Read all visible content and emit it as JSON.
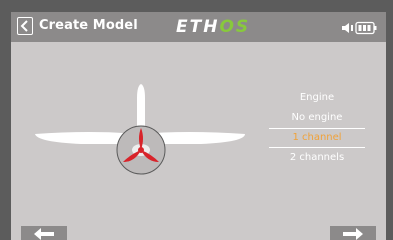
{
  "header": {
    "title": "Create Model",
    "logo_main": "ETH",
    "logo_accent": "OS"
  },
  "selector": {
    "label": "Engine",
    "options": [
      "No engine",
      "1 channel",
      "2 channels"
    ],
    "selected_index": 1
  },
  "colors": {
    "accent": "#f0a23a",
    "logo_accent": "#88c93c",
    "header_bg": "#8c8a8a",
    "screen_bg": "#ccc9c9",
    "propeller": "#d8232a"
  },
  "icons": {
    "back": "chevron-left-icon",
    "status": "speaker-battery-icon",
    "prev": "arrow-left-icon",
    "next": "arrow-right-icon"
  }
}
